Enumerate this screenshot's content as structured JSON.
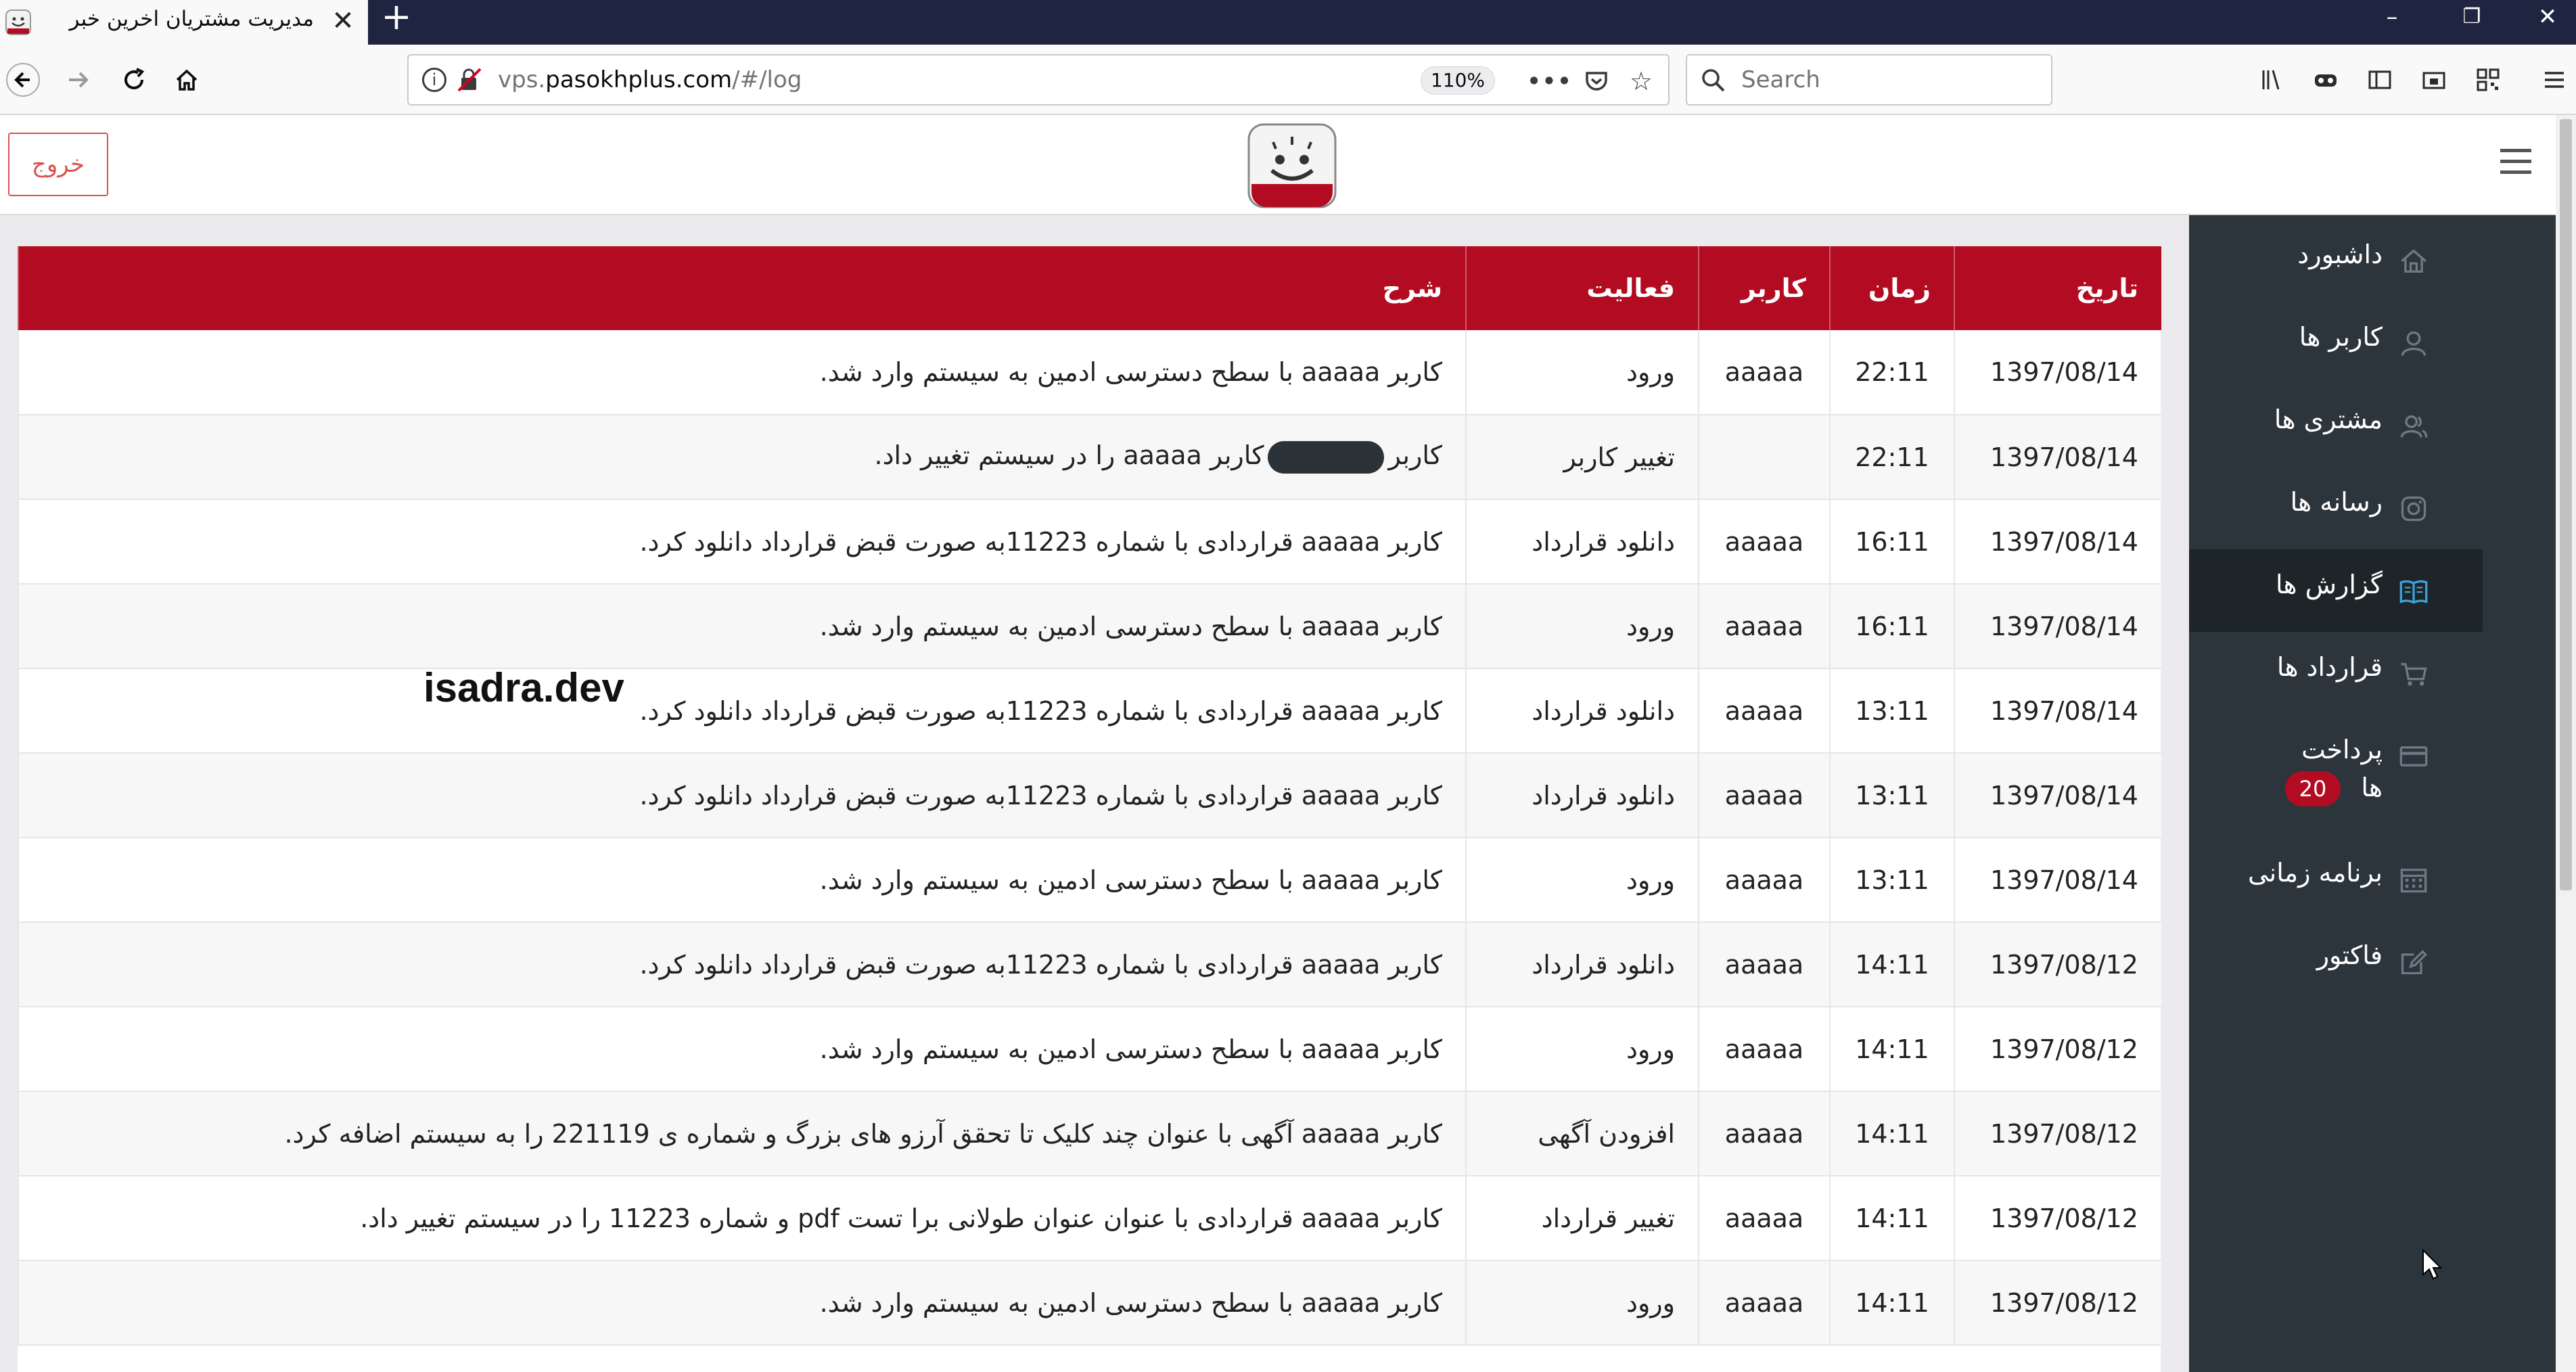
{
  "browser": {
    "tab_title": "مدیریت مشتریان اخرین خبر",
    "url_host": "vps.",
    "url_domain": "pasokhplus.com",
    "url_path": "/#/log",
    "zoom": "110%",
    "search_placeholder": "Search"
  },
  "header": {
    "logout_label": "خروج"
  },
  "sidebar": {
    "items": [
      {
        "label": "داشبورد",
        "icon": "home-icon"
      },
      {
        "label": "کاربر ها",
        "icon": "user-icon"
      },
      {
        "label": "مشتری ها",
        "icon": "customers-icon"
      },
      {
        "label": "رسانه ها",
        "icon": "instagram-icon"
      },
      {
        "label": "گزارش ها",
        "icon": "book-icon"
      },
      {
        "label": "قرارداد ها",
        "icon": "cart-icon"
      },
      {
        "label": "پرداخت",
        "label2": "ها",
        "icon": "credit-card-icon",
        "badge": "20"
      },
      {
        "label": "برنامه زمانی",
        "icon": "calendar-icon"
      },
      {
        "label": "فاکتور",
        "icon": "edit-icon"
      }
    ]
  },
  "table": {
    "columns": [
      "تاریخ",
      "زمان",
      "کاربر",
      "فعالیت",
      "شرح"
    ],
    "rows": [
      {
        "date": "1397/08/14",
        "time": "22:11",
        "user": "aaaaa",
        "activity": "ورود",
        "desc": "کاربر aaaaa با سطح دسترسی ادمین به سیستم وارد شد."
      },
      {
        "date": "1397/08/14",
        "time": "22:11",
        "user": "",
        "activity": "تغییر کاربر",
        "desc_pre": "کاربر",
        "desc_post": "کاربر aaaaa را در سیستم تغییر داد."
      },
      {
        "date": "1397/08/14",
        "time": "16:11",
        "user": "aaaaa",
        "activity": "دانلود قرارداد",
        "desc": "کاربر aaaaa قراردادی با شماره 11223به صورت قبض قرارداد دانلود کرد."
      },
      {
        "date": "1397/08/14",
        "time": "16:11",
        "user": "aaaaa",
        "activity": "ورود",
        "desc": "کاربر aaaaa با سطح دسترسی ادمین به سیستم وارد شد."
      },
      {
        "date": "1397/08/14",
        "time": "13:11",
        "user": "aaaaa",
        "activity": "دانلود قرارداد",
        "desc": "کاربر aaaaa قراردادی با شماره 11223به صورت قبض قرارداد دانلود کرد."
      },
      {
        "date": "1397/08/14",
        "time": "13:11",
        "user": "aaaaa",
        "activity": "دانلود قرارداد",
        "desc": "کاربر aaaaa قراردادی با شماره 11223به صورت قبض قرارداد دانلود کرد."
      },
      {
        "date": "1397/08/14",
        "time": "13:11",
        "user": "aaaaa",
        "activity": "ورود",
        "desc": "کاربر aaaaa با سطح دسترسی ادمین به سیستم وارد شد."
      },
      {
        "date": "1397/08/12",
        "time": "14:11",
        "user": "aaaaa",
        "activity": "دانلود قرارداد",
        "desc": "کاربر aaaaa قراردادی با شماره 11223به صورت قبض قرارداد دانلود کرد."
      },
      {
        "date": "1397/08/12",
        "time": "14:11",
        "user": "aaaaa",
        "activity": "ورود",
        "desc": "کاربر aaaaa با سطح دسترسی ادمین به سیستم وارد شد."
      },
      {
        "date": "1397/08/12",
        "time": "14:11",
        "user": "aaaaa",
        "activity": "افزودن آگهی",
        "desc": "کاربر aaaaa آگهی با عنوان چند کلیک تا تحقق آرزو های بزرگ و شماره ی 221119 را به سیستم اضافه کرد."
      },
      {
        "date": "1397/08/12",
        "time": "14:11",
        "user": "aaaaa",
        "activity": "تغییر قرارداد",
        "desc": "کاربر aaaaa قراردادی با عنوان عنوان طولانی برا تست pdf و شماره 11223 را در سیستم تغییر داد."
      },
      {
        "date": "1397/08/12",
        "time": "14:11",
        "user": "aaaaa",
        "activity": "ورود",
        "desc": "کاربر aaaaa با سطح دسترسی ادمین به سیستم وارد شد."
      }
    ]
  },
  "watermark": "isadra.dev",
  "colors": {
    "accent": "#b30c22",
    "sidebar_bg": "#2d353c",
    "active_icon": "#3ca2dc"
  }
}
